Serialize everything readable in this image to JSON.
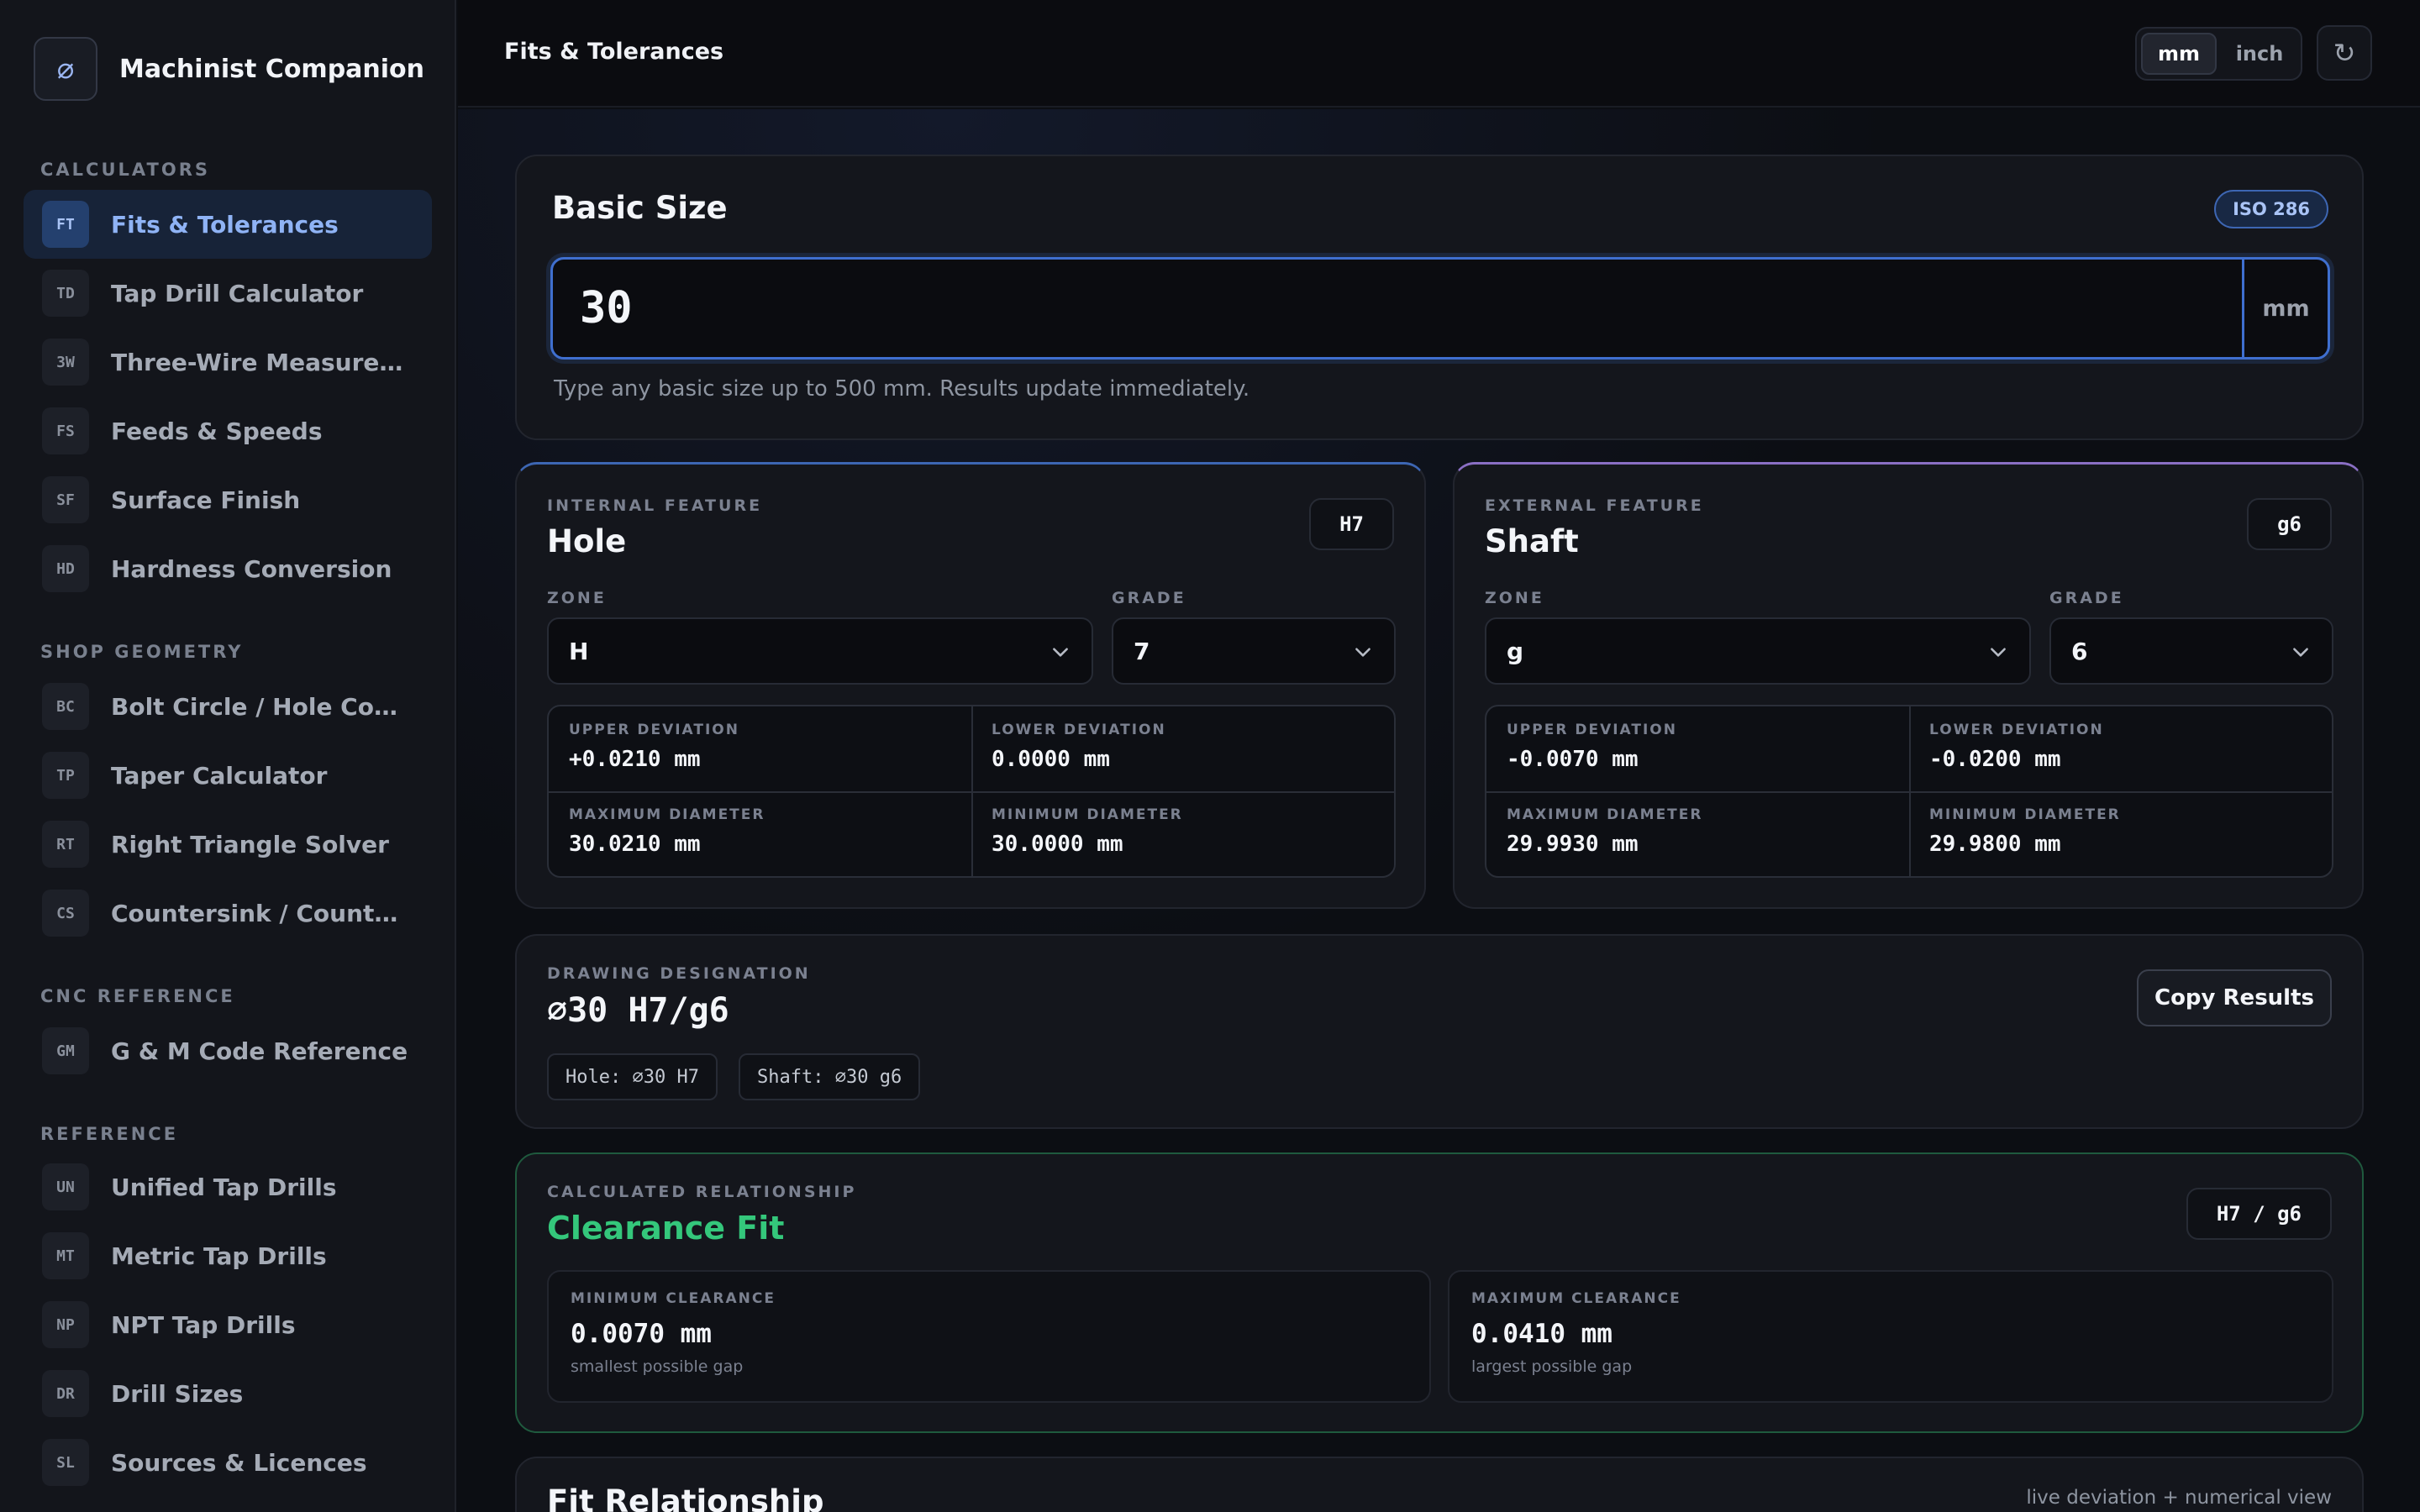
{
  "app": {
    "name": "Machinist Companion",
    "logo_glyph": "⌀"
  },
  "sidebar": {
    "sections": [
      {
        "title": "CALCULATORS",
        "items": [
          {
            "code": "FT",
            "label": "Fits & Tolerances",
            "active": true
          },
          {
            "code": "TD",
            "label": "Tap Drill Calculator"
          },
          {
            "code": "3W",
            "label": "Three-Wire Measurem..."
          },
          {
            "code": "FS",
            "label": "Feeds & Speeds"
          },
          {
            "code": "SF",
            "label": "Surface Finish"
          },
          {
            "code": "HD",
            "label": "Hardness Conversion"
          }
        ]
      },
      {
        "title": "SHOP GEOMETRY",
        "items": [
          {
            "code": "BC",
            "label": "Bolt Circle / Hole Coor..."
          },
          {
            "code": "TP",
            "label": "Taper Calculator"
          },
          {
            "code": "RT",
            "label": "Right Triangle Solver"
          },
          {
            "code": "CS",
            "label": "Countersink / Counter..."
          }
        ]
      },
      {
        "title": "CNC REFERENCE",
        "items": [
          {
            "code": "GM",
            "label": "G & M Code Reference"
          }
        ]
      },
      {
        "title": "REFERENCE",
        "items": [
          {
            "code": "UN",
            "label": "Unified Tap Drills"
          },
          {
            "code": "MT",
            "label": "Metric Tap Drills"
          },
          {
            "code": "NP",
            "label": "NPT Tap Drills"
          },
          {
            "code": "DR",
            "label": "Drill Sizes"
          },
          {
            "code": "SL",
            "label": "Sources & Licences"
          }
        ]
      }
    ]
  },
  "topbar": {
    "title": "Fits & Tolerances",
    "unit_mm": "mm",
    "unit_inch": "inch",
    "refresh_glyph": "↻"
  },
  "basic_size": {
    "title": "Basic Size",
    "standard_badge": "ISO 286",
    "value": "30",
    "unit": "mm",
    "hint": "Type any basic size up to 500 mm. Results update immediately."
  },
  "hole": {
    "eyebrow": "INTERNAL FEATURE",
    "title": "Hole",
    "chip": "H7",
    "zone_label": "ZONE",
    "zone_value": "H",
    "grade_label": "GRADE",
    "grade_value": "7",
    "upper_label": "UPPER DEVIATION",
    "upper_value": "+0.0210 mm",
    "lower_label": "LOWER DEVIATION",
    "lower_value": "0.0000 mm",
    "max_label": "MAXIMUM DIAMETER",
    "max_value": "30.0210 mm",
    "min_label": "MINIMUM DIAMETER",
    "min_value": "30.0000 mm"
  },
  "shaft": {
    "eyebrow": "EXTERNAL FEATURE",
    "title": "Shaft",
    "chip": "g6",
    "zone_label": "ZONE",
    "zone_value": "g",
    "grade_label": "GRADE",
    "grade_value": "6",
    "upper_label": "UPPER DEVIATION",
    "upper_value": "-0.0070 mm",
    "lower_label": "LOWER DEVIATION",
    "lower_value": "-0.0200 mm",
    "max_label": "MAXIMUM DIAMETER",
    "max_value": "29.9930 mm",
    "min_label": "MINIMUM DIAMETER",
    "min_value": "29.9800 mm"
  },
  "designation": {
    "eyebrow": "DRAWING DESIGNATION",
    "value": "⌀30 H7/g6",
    "hole_tag": "Hole: ⌀30 H7",
    "shaft_tag": "Shaft: ⌀30 g6",
    "copy_label": "Copy Results"
  },
  "relationship": {
    "eyebrow": "CALCULATED RELATIONSHIP",
    "title": "Clearance Fit",
    "chip": "H7 / g6",
    "min_label": "MINIMUM CLEARANCE",
    "min_value": "0.0070 mm",
    "min_sub": "smallest possible gap",
    "max_label": "MAXIMUM CLEARANCE",
    "max_value": "0.0410 mm",
    "max_sub": "largest possible gap"
  },
  "fit_section": {
    "title": "Fit Relationship",
    "note": "live deviation + numerical view"
  }
}
